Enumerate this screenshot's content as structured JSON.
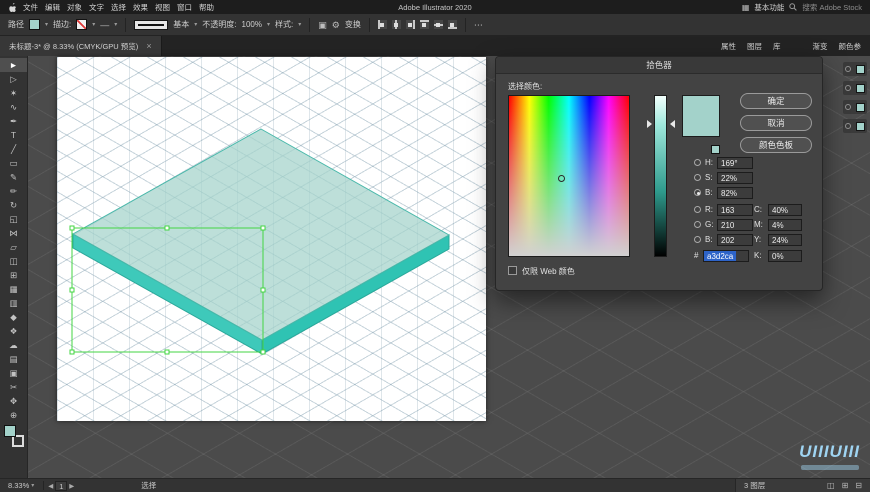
{
  "menubar": {
    "menus": [
      "文件",
      "编辑",
      "对象",
      "文字",
      "选择",
      "效果",
      "视图",
      "窗口",
      "帮助"
    ],
    "app_title": "Adobe Illustrator 2020",
    "workspace": "基本功能",
    "search": "搜索 Adobe Stock"
  },
  "control_bar": {
    "selection_type": "路径",
    "fill_color": "#a3d2ca",
    "stroke_label": "描边:",
    "brush_name": "基本",
    "opacity_label": "不透明度:",
    "opacity_value": "100%",
    "style_label": "样式:",
    "transform_label": "变换"
  },
  "document_tab": {
    "title": "未标题-3* @ 8.33% (CMYK/GPU 预览)",
    "close": "×"
  },
  "panel_tabs": {
    "group1": [
      "属性",
      "图层",
      "库"
    ],
    "group2": [
      "渐变",
      "颜色参"
    ]
  },
  "tools": [
    {
      "name": "selection-tool",
      "glyph": "►"
    },
    {
      "name": "direct-selection-tool",
      "glyph": "▷"
    },
    {
      "name": "magic-wand-tool",
      "glyph": "✶"
    },
    {
      "name": "lasso-tool",
      "glyph": "∿"
    },
    {
      "name": "pen-tool",
      "glyph": "✒"
    },
    {
      "name": "type-tool",
      "glyph": "T"
    },
    {
      "name": "line-segment-tool",
      "glyph": "╱"
    },
    {
      "name": "rectangle-tool",
      "glyph": "▭"
    },
    {
      "name": "paintbrush-tool",
      "glyph": "✎"
    },
    {
      "name": "pencil-tool",
      "glyph": "✏"
    },
    {
      "name": "rotate-tool",
      "glyph": "↻"
    },
    {
      "name": "scale-tool",
      "glyph": "◱"
    },
    {
      "name": "width-tool",
      "glyph": "⋈"
    },
    {
      "name": "free-transform-tool",
      "glyph": "▱"
    },
    {
      "name": "shape-builder-tool",
      "glyph": "◫"
    },
    {
      "name": "perspective-grid-tool",
      "glyph": "⊞"
    },
    {
      "name": "mesh-tool",
      "glyph": "▦"
    },
    {
      "name": "gradient-tool",
      "glyph": "▥"
    },
    {
      "name": "eyedropper-tool",
      "glyph": "◆"
    },
    {
      "name": "blend-tool",
      "glyph": "❖"
    },
    {
      "name": "symbol-sprayer-tool",
      "glyph": "☁"
    },
    {
      "name": "graph-tool",
      "glyph": "▤"
    },
    {
      "name": "artboard-tool",
      "glyph": "▣"
    },
    {
      "name": "slice-tool",
      "glyph": "✂"
    },
    {
      "name": "hand-tool",
      "glyph": "✥"
    },
    {
      "name": "zoom-tool",
      "glyph": "⊕"
    }
  ],
  "canvas": {
    "object_colors": {
      "top": "#a3d2ca",
      "left_side": "#3ec9ba",
      "right_side": "#2fc3b3",
      "outline": "#2aa89a",
      "selection": "#43d643"
    }
  },
  "color_picker": {
    "title": "拾色器",
    "prompt": "选择颜色:",
    "ok": "确定",
    "cancel": "取消",
    "swatches_button": "颜色色板",
    "web_only": "仅限 Web 颜色",
    "current_color": "#a3d2ca",
    "hsb": [
      {
        "label": "H:",
        "value": "169°"
      },
      {
        "label": "S:",
        "value": "22%"
      },
      {
        "label": "B:",
        "value": "82%"
      }
    ],
    "rgb": [
      {
        "label": "R:",
        "value": "163"
      },
      {
        "label": "G:",
        "value": "210"
      },
      {
        "label": "B:",
        "value": "202"
      }
    ],
    "hex_label": "#",
    "hex_value": "a3d2ca",
    "cmyk": [
      {
        "label": "C:",
        "value": "40%"
      },
      {
        "label": "M:",
        "value": "4%"
      },
      {
        "label": "Y:",
        "value": "24%"
      },
      {
        "label": "K:",
        "value": "0%"
      }
    ]
  },
  "status_bar": {
    "zoom": "8.33%",
    "artboard_number": "1",
    "tool": "选择"
  },
  "layers_panel": {
    "status": "3 图层"
  },
  "watermark": "UIIIUIII"
}
